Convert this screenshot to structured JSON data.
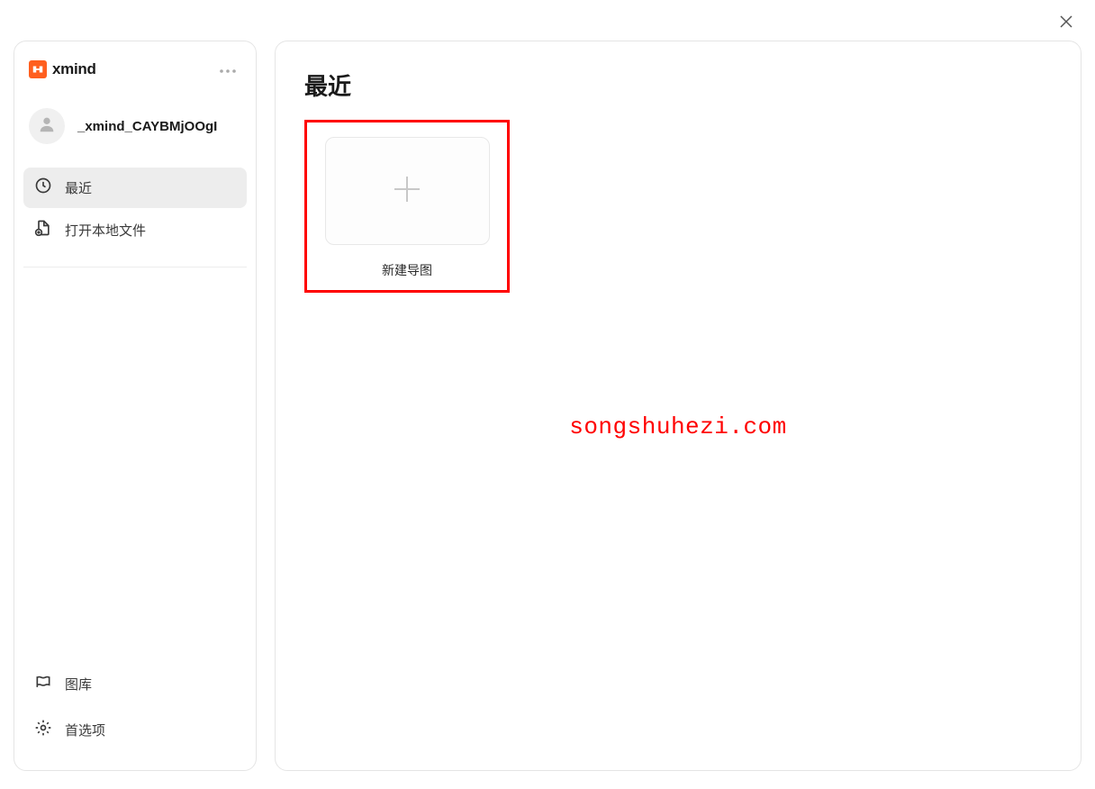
{
  "app": {
    "name": "xmind"
  },
  "user": {
    "username": "_xmind_CAYBMjOOgI"
  },
  "sidebar": {
    "nav": [
      {
        "label": "最近",
        "active": true
      },
      {
        "label": "打开本地文件",
        "active": false
      }
    ],
    "bottom": [
      {
        "label": "图库"
      },
      {
        "label": "首选项"
      }
    ]
  },
  "main": {
    "title": "最近",
    "create_label": "新建导图"
  },
  "watermark": "songshuhezi.com",
  "highlight_color": "#ff0000"
}
